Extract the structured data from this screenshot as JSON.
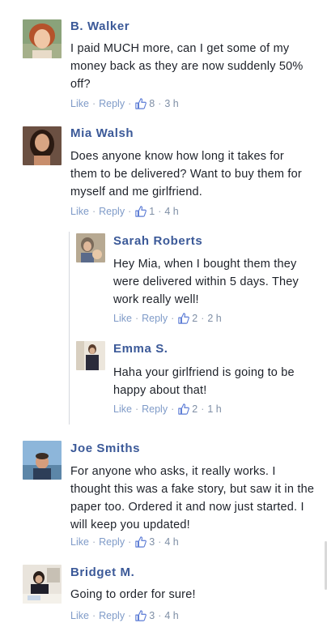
{
  "comments": [
    {
      "name": "B. Walker",
      "text": "I paid MUCH more, can I get some of my money back as they are now suddenly 50% off?",
      "like": "Like",
      "reply": "Reply",
      "likes": "8",
      "time": "3 h",
      "avatar_icon": "woman-curly-hair-avatar"
    },
    {
      "name": "Mia Walsh",
      "text": "Does anyone know how long it takes for them to be delivered? Want to buy them for myself and me girlfriend.",
      "like": "Like",
      "reply": "Reply",
      "likes": "1",
      "time": "4 h",
      "avatar_icon": "woman-long-hair-avatar"
    },
    {
      "name": "Sarah Roberts",
      "text": "Hey Mia, when I bought them they were delivered within 5 days. They work really well!",
      "like": "Like",
      "reply": "Reply",
      "likes": "2",
      "time": "2 h",
      "avatar_icon": "woman-with-child-avatar"
    },
    {
      "name": "Emma S.",
      "text": "Haha your girlfriend is going to be happy about that!",
      "like": "Like",
      "reply": "Reply",
      "likes": "2",
      "time": "1 h",
      "avatar_icon": "woman-dark-coat-avatar"
    },
    {
      "name": "Joe Smiths",
      "text": "For anyone who asks, it really works. I thought this was a fake story, but saw it in the paper too. Ordered it and now just started. I will keep you updated!",
      "like": "Like",
      "reply": "Reply",
      "likes": "3",
      "time": "4 h",
      "avatar_icon": "man-outdoor-avatar"
    },
    {
      "name": "Bridget M.",
      "text": "Going to order for sure!",
      "like": "Like",
      "reply": "Reply",
      "likes": "3",
      "time": "4 h",
      "avatar_icon": "woman-at-desk-avatar"
    }
  ],
  "separator": "·",
  "colors": {
    "name": "#3b5998",
    "text": "#1d2129",
    "meta": "#7f8fa6",
    "link": "#7f9bc8",
    "thumb": "#5b7bd5"
  }
}
